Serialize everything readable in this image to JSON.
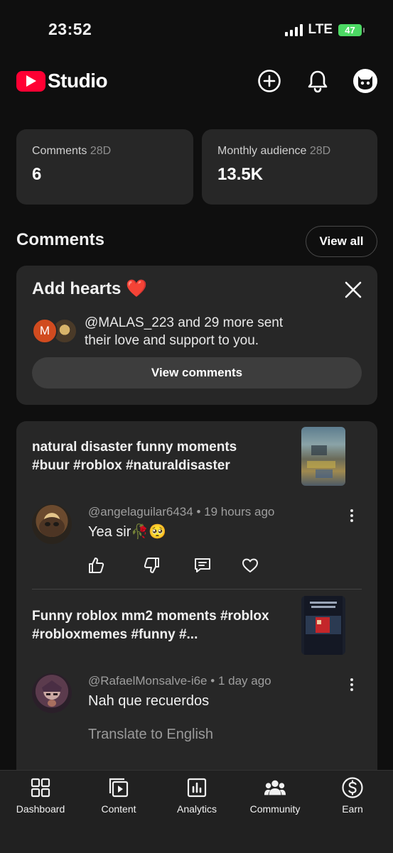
{
  "status": {
    "time": "23:52",
    "network": "LTE",
    "battery": "47"
  },
  "header": {
    "app_name": "Studio"
  },
  "stats": [
    {
      "label": "Comments",
      "period": "28D",
      "value": "6"
    },
    {
      "label": "Monthly audience",
      "period": "28D",
      "value": "13.5K"
    }
  ],
  "comments_section": {
    "title": "Comments",
    "view_all": "View all"
  },
  "hearts_card": {
    "title": "Add hearts",
    "emoji": "❤️",
    "message": "@MALAS_223 and 29 more sent their love and support to you.",
    "button": "View comments",
    "avatar_initial": "M"
  },
  "videos": [
    {
      "title": "natural disaster funny moments #buur #roblox #naturaldisaster",
      "comment": {
        "author": "@angelaguilar6434",
        "time": "19 hours ago",
        "text": "Yea sir🥀🥺"
      }
    },
    {
      "title": "Funny roblox mm2 moments #roblox #robloxmemes #funny #...",
      "comment": {
        "author": "@RafaelMonsalve-i6e",
        "time": "1 day ago",
        "text": "Nah que recuerdos",
        "translate": "Translate to English"
      }
    }
  ],
  "separator": "•",
  "nav": [
    {
      "label": "Dashboard",
      "icon": "dashboard-icon"
    },
    {
      "label": "Content",
      "icon": "content-icon"
    },
    {
      "label": "Analytics",
      "icon": "analytics-icon"
    },
    {
      "label": "Community",
      "icon": "community-icon"
    },
    {
      "label": "Earn",
      "icon": "earn-icon"
    }
  ],
  "colors": {
    "brand_red": "#ff0033",
    "background": "#0f0f0f",
    "card": "#272727",
    "battery_green": "#4cd964"
  }
}
